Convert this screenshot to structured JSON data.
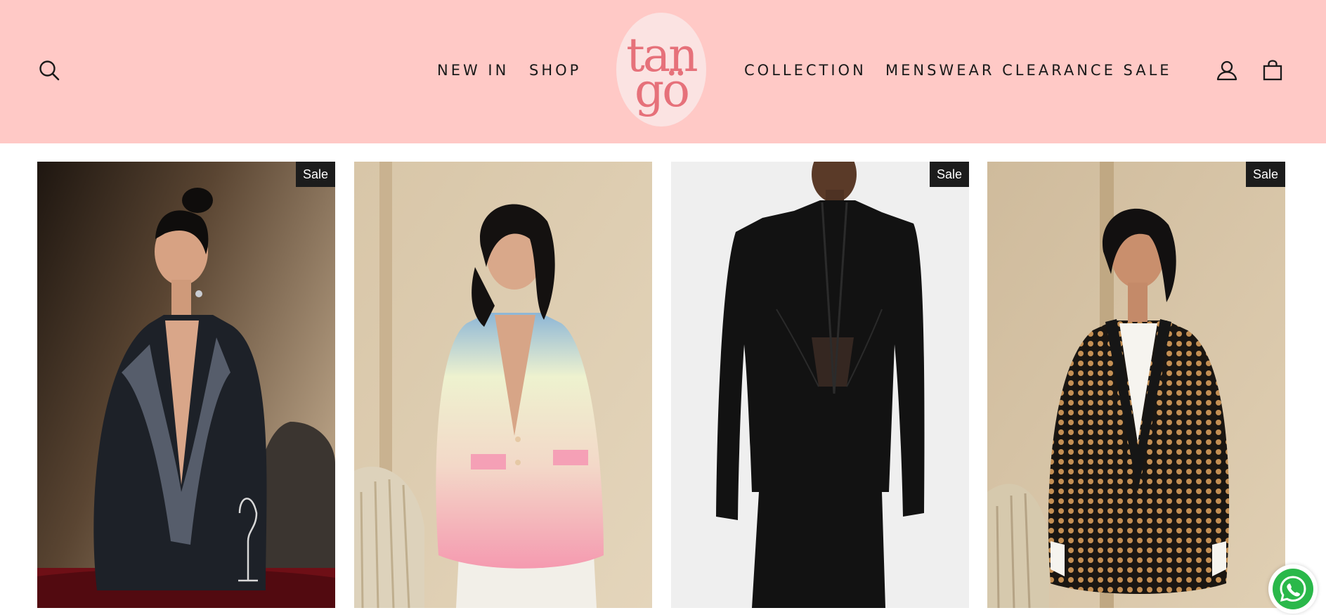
{
  "header": {
    "background": "#ffc9c6",
    "logo_text": [
      "tan",
      "gö"
    ],
    "nav_left": [
      {
        "label": "NEW IN"
      },
      {
        "label": "SHOP"
      }
    ],
    "nav_right": [
      {
        "label": "COLLECTION"
      },
      {
        "label": "MENSWEAR CLEARANCE SALE"
      }
    ],
    "icons": {
      "search": "search-icon",
      "account": "user-icon",
      "cart": "cart-icon"
    }
  },
  "products": [
    {
      "badge": "Sale",
      "image": "woman in black pearl-embellished blazer"
    },
    {
      "badge": "",
      "image": "woman in pastel ombre blazer"
    },
    {
      "badge": "Sale",
      "image": "model in black corset blazer"
    },
    {
      "badge": "Sale",
      "image": "woman in gold embellished blazer"
    }
  ],
  "chat_widget": {
    "icon": "whatsapp-icon",
    "color": "#2ab84a"
  }
}
